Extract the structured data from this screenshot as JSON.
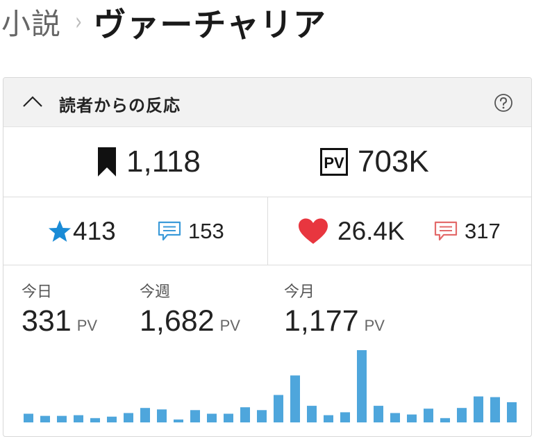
{
  "breadcrumb": {
    "parent": "小説",
    "separator": "›",
    "title": "ヴァーチャリア"
  },
  "panel": {
    "title": "読者からの反応",
    "collapse_icon": "chevron-up-icon",
    "help_icon": "help-icon"
  },
  "stats": {
    "bookmarks": "1,118",
    "pageviews": "703K",
    "pv_badge": "PV",
    "rating": "413",
    "reviews": "153",
    "likes": "26.4K",
    "comments": "317"
  },
  "pv": {
    "today_label": "今日",
    "today_value": "331",
    "week_label": "今週",
    "week_value": "1,682",
    "month_label": "今月",
    "month_value": "1,177",
    "unit": "PV"
  },
  "colors": {
    "bar": "#4ea6dc",
    "star": "#1a8bd6",
    "review_icon": "#3a9ad9",
    "heart": "#e8363f",
    "comment_icon": "#e36a6a"
  },
  "chart_data": {
    "type": "bar",
    "values": [
      12,
      9,
      9,
      10,
      6,
      8,
      13,
      20,
      18,
      4,
      17,
      12,
      12,
      21,
      17,
      38,
      65,
      23,
      10,
      14,
      100,
      23,
      13,
      11,
      19,
      6,
      20,
      36,
      35,
      28
    ],
    "ylim": [
      0,
      100
    ],
    "grid": false
  }
}
